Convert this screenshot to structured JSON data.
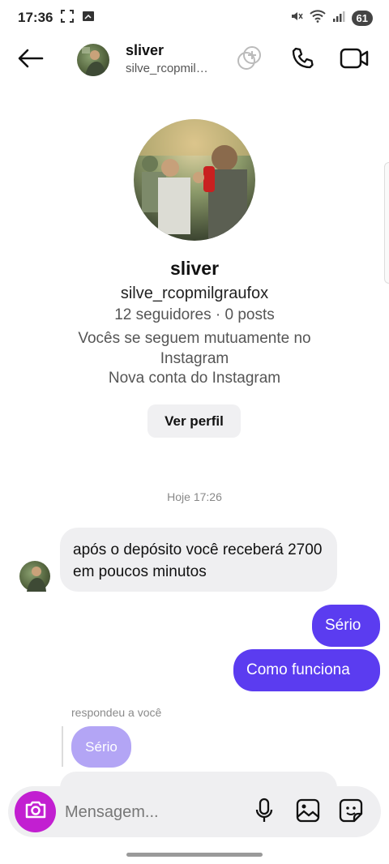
{
  "status_bar": {
    "time": "17:36",
    "battery": "61",
    "icons": [
      "screenshot-icon",
      "cast-icon",
      "mute-icon",
      "wifi-icon",
      "signal-icon"
    ]
  },
  "header": {
    "back_icon": "arrow-left-icon",
    "name": "sliver",
    "username": "silve_rcopmilgraufox",
    "icons": [
      "add-people-icon",
      "phone-icon",
      "video-icon"
    ]
  },
  "profile": {
    "name": "sliver",
    "username": "silve_rcopmilgraufox",
    "stats": "12 seguidores · 0 posts",
    "mutual": "Vocês se seguem mutuamente no Instagram",
    "new_account": "Nova conta do Instagram",
    "view_profile_label": "Ver perfil"
  },
  "timestamp": "Hoje 17:26",
  "messages": {
    "incoming_1": "após o depósito você receberá 2700 em poucos minutos",
    "outgoing_1": "Sério",
    "outgoing_2": "Como funciona",
    "reply_label": "respondeu a você",
    "reply_quote": "Sério"
  },
  "composer": {
    "placeholder": "Mensagem...",
    "icons": [
      "camera-icon",
      "microphone-icon",
      "gallery-icon",
      "sticker-icon"
    ]
  },
  "colors": {
    "accent_purple": "#5b3cf0",
    "camera_magenta": "#c21fd1",
    "bubble_gray": "#efeff1"
  }
}
